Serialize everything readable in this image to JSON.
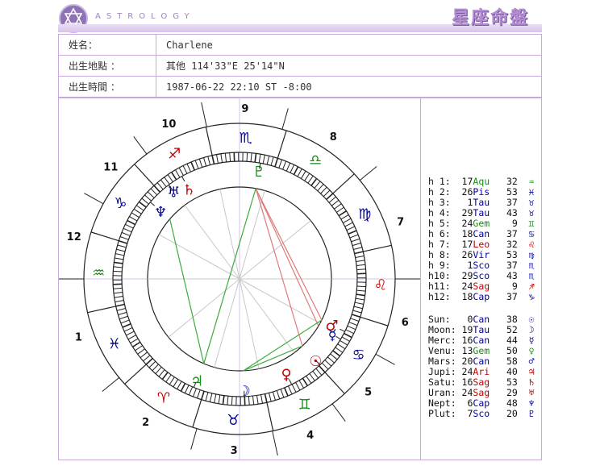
{
  "header": {
    "brand": "ASTROLOGY",
    "title_cn": "星座命盤",
    "accent": "#b58fd6",
    "border_color": "#c9a8e0"
  },
  "info": {
    "name_label": "姓名：",
    "name_value": "Charlene",
    "place_label": "出生地點 ：",
    "place_value": "其他 114'33\"E 25'14\"N",
    "time_label": "出生時間 ：",
    "time_value": "1987-06-22 22:10 ST -8:00"
  },
  "wheel": {
    "house_numbers": [
      "1",
      "2",
      "3",
      "4",
      "5",
      "6",
      "7",
      "8",
      "9",
      "10",
      "11",
      "12"
    ],
    "signs": [
      {
        "glyph": "♒",
        "name": "aquarius",
        "color": "#1a8a1a"
      },
      {
        "glyph": "♓",
        "name": "pisces",
        "color": "#000099"
      },
      {
        "glyph": "♈",
        "name": "aries",
        "color": "#c00000"
      },
      {
        "glyph": "♉",
        "name": "taurus",
        "color": "#000099"
      },
      {
        "glyph": "♊",
        "name": "gemini",
        "color": "#1a8a1a"
      },
      {
        "glyph": "♋",
        "name": "cancer",
        "color": "#000099"
      },
      {
        "glyph": "♌",
        "name": "leo",
        "color": "#c00000"
      },
      {
        "glyph": "♍",
        "name": "virgo",
        "color": "#000099"
      },
      {
        "glyph": "♎",
        "name": "libra",
        "color": "#1a8a1a"
      },
      {
        "glyph": "♏",
        "name": "scorpio",
        "color": "#000099"
      },
      {
        "glyph": "♐",
        "name": "sagittarius",
        "color": "#c00000"
      },
      {
        "glyph": "♑",
        "name": "capricorn",
        "color": "#000099"
      }
    ],
    "planets": [
      {
        "glyph": "☉",
        "name": "sun",
        "color": "#c00000"
      },
      {
        "glyph": "☽",
        "name": "moon",
        "color": "#000099"
      },
      {
        "glyph": "☿",
        "name": "mercury",
        "color": "#000099"
      },
      {
        "glyph": "♀",
        "name": "venus",
        "color": "#c00000"
      },
      {
        "glyph": "♂",
        "name": "mars",
        "color": "#c00000"
      },
      {
        "glyph": "♃",
        "name": "jupiter",
        "color": "#1a8a1a"
      },
      {
        "glyph": "♄",
        "name": "saturn",
        "color": "#c00000"
      },
      {
        "glyph": "♅",
        "name": "uranus",
        "color": "#000099"
      },
      {
        "glyph": "♆",
        "name": "neptune",
        "color": "#000099"
      },
      {
        "glyph": "♇",
        "name": "pluto",
        "color": "#1a8a1a"
      }
    ]
  },
  "houses": [
    {
      "label": "h 1:",
      "deg": "17",
      "sign": "Aqu",
      "min": "32",
      "glyph": "♒",
      "cls": "sign"
    },
    {
      "label": "h 2:",
      "deg": "26",
      "sign": "Pis",
      "min": "53",
      "glyph": "♓",
      "cls": "water"
    },
    {
      "label": "h 3:",
      "deg": "1",
      "sign": "Tau",
      "min": "37",
      "glyph": "♉",
      "cls": "water"
    },
    {
      "label": "h 4:",
      "deg": "29",
      "sign": "Tau",
      "min": "43",
      "glyph": "♉",
      "cls": "water"
    },
    {
      "label": "h 5:",
      "deg": "24",
      "sign": "Gem",
      "min": "9",
      "glyph": "♊",
      "cls": "sign"
    },
    {
      "label": "h 6:",
      "deg": "18",
      "sign": "Can",
      "min": "37",
      "glyph": "♋",
      "cls": "water"
    },
    {
      "label": "h 7:",
      "deg": "17",
      "sign": "Leo",
      "min": "32",
      "glyph": "♌",
      "cls": "fire"
    },
    {
      "label": "h 8:",
      "deg": "26",
      "sign": "Vir",
      "min": "53",
      "glyph": "♍",
      "cls": "water"
    },
    {
      "label": "h 9:",
      "deg": "1",
      "sign": "Sco",
      "min": "37",
      "glyph": "♏",
      "cls": "water"
    },
    {
      "label": "h10:",
      "deg": "29",
      "sign": "Sco",
      "min": "43",
      "glyph": "♏",
      "cls": "water"
    },
    {
      "label": "h11:",
      "deg": "24",
      "sign": "Sag",
      "min": "9",
      "glyph": "♐",
      "cls": "fire"
    },
    {
      "label": "h12:",
      "deg": "18",
      "sign": "Cap",
      "min": "37",
      "glyph": "♑",
      "cls": "water"
    }
  ],
  "planets": [
    {
      "label": "Sun:",
      "deg": "0",
      "sign": "Can",
      "min": "38",
      "glyph": "☉",
      "cls": "water"
    },
    {
      "label": "Moon:",
      "deg": "19",
      "sign": "Tau",
      "min": "52",
      "glyph": "☽",
      "cls": "water"
    },
    {
      "label": "Merc:",
      "deg": "16",
      "sign": "Can",
      "min": "44",
      "glyph": "☿",
      "cls": "water"
    },
    {
      "label": "Venu:",
      "deg": "13",
      "sign": "Gem",
      "min": "50",
      "glyph": "♀",
      "cls": "sign"
    },
    {
      "label": "Mars:",
      "deg": "20",
      "sign": "Can",
      "min": "58",
      "glyph": "♂",
      "cls": "water"
    },
    {
      "label": "Jupi:",
      "deg": "24",
      "sign": "Ari",
      "min": "40",
      "glyph": "♃",
      "cls": "fire"
    },
    {
      "label": "Satu:",
      "deg": "16",
      "sign": "Sag",
      "min": "53",
      "glyph": "♄",
      "cls": "fire"
    },
    {
      "label": "Uran:",
      "deg": "24",
      "sign": "Sag",
      "min": "29",
      "glyph": "♅",
      "cls": "fire"
    },
    {
      "label": "Nept:",
      "deg": "6",
      "sign": "Cap",
      "min": "48",
      "glyph": "♆",
      "cls": "water"
    },
    {
      "label": "Plut:",
      "deg": "7",
      "sign": "Sco",
      "min": "20",
      "glyph": "♇",
      "cls": "water"
    }
  ]
}
